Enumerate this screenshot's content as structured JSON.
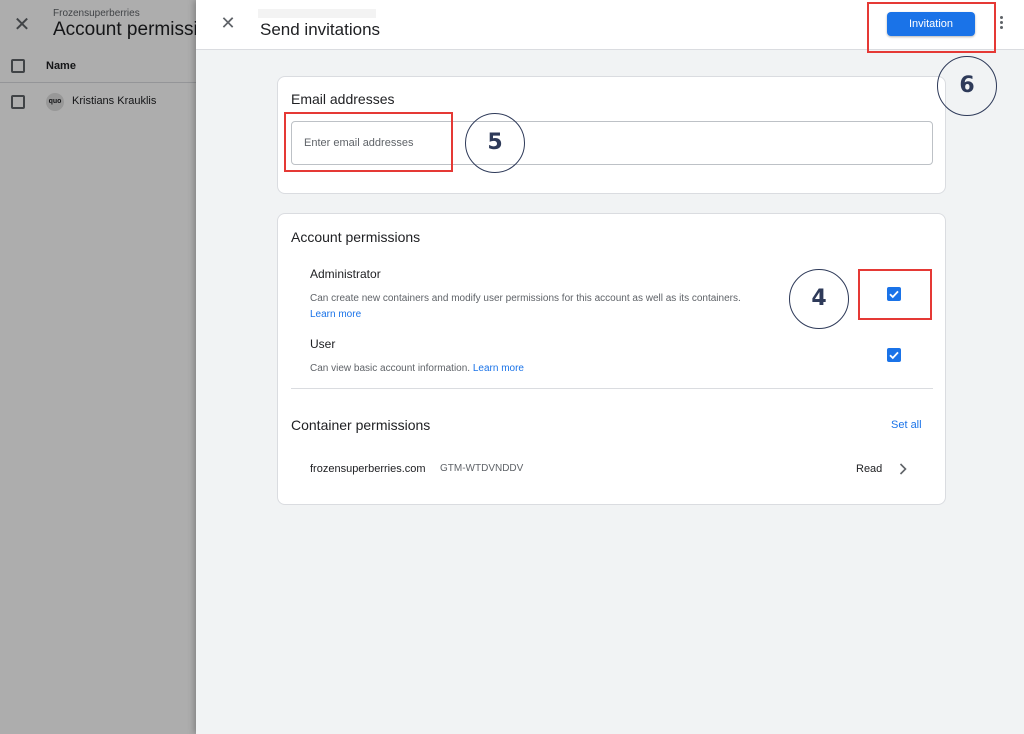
{
  "background": {
    "account_name": "Frozensuperberries",
    "page_title": "Account permissions",
    "column_name": "Name",
    "user": {
      "avatar_text": "quo",
      "name": "Kristians Krauklis"
    }
  },
  "drawer": {
    "title": "Send invitations",
    "invite_button_label": "Invitation",
    "close_icon": "close-icon",
    "more_icon": "more-vert-icon"
  },
  "email_card": {
    "heading": "Email addresses",
    "input_placeholder": "Enter email addresses",
    "input_value": ""
  },
  "permissions_card": {
    "heading": "Account permissions",
    "roles": [
      {
        "label": "Administrator",
        "description": "Can create new containers and modify user permissions for this account as well as its containers.",
        "learn_more": "Learn more",
        "checked": true
      },
      {
        "label": "User",
        "description": "Can view basic account information.",
        "learn_more": "Learn more",
        "checked": true
      }
    ],
    "container_heading": "Container permissions",
    "set_all_label": "Set all",
    "containers": [
      {
        "name": "frozensuperberries.com",
        "id": "GTM-WTDVNDDV",
        "access": "Read"
      }
    ]
  },
  "annotations": [
    {
      "number": "4"
    },
    {
      "number": "5"
    },
    {
      "number": "6"
    }
  ],
  "colors": {
    "primary": "#1a73e8",
    "highlight": "#e53935",
    "annotation": "#2e3a59",
    "drawer_background": "#f1f3f4"
  }
}
